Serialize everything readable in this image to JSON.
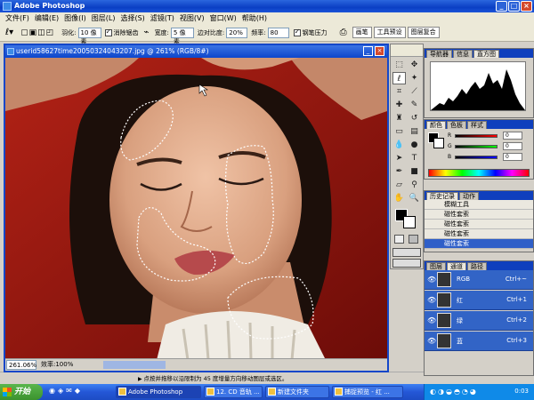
{
  "app": {
    "title": "Adobe Photoshop"
  },
  "menu": [
    "文件(F)",
    "编辑(E)",
    "图像(I)",
    "图层(L)",
    "选择(S)",
    "滤镜(T)",
    "视图(V)",
    "窗口(W)",
    "帮助(H)"
  ],
  "options": {
    "feather_label": "羽化:",
    "feather_value": "10 像素",
    "antialias_label": "消除锯齿",
    "width_label": "宽度:",
    "width_value": "5 像素",
    "edge_contrast_label": "边对比度:",
    "edge_contrast_value": "20%",
    "frequency_label": "频率:",
    "frequency_value": "80",
    "pen_pressure_label": "钢笔压力",
    "tabs": [
      "画笔",
      "工具预设",
      "图层复合"
    ]
  },
  "document": {
    "title": "userid58627time20050324043207.jpg @ 261% (RGB/8#)",
    "zoom": "261.06%",
    "efficiency": "效率:100%",
    "hint": "点按并拖移以沿限制为 45 度增量方向移动图层或选区。"
  },
  "navigator": {
    "tabs": [
      "导航器",
      "信息",
      "直方图"
    ]
  },
  "color": {
    "tabs": [
      "颜色",
      "色板",
      "样式"
    ],
    "channels": [
      {
        "label": "R",
        "value": "0"
      },
      {
        "label": "G",
        "value": "0"
      },
      {
        "label": "B",
        "value": "0"
      }
    ]
  },
  "history": {
    "tabs": [
      "历史记录",
      "动作"
    ],
    "items": [
      "磁性套索",
      "磁性套索",
      "磁性套索",
      "磁性套索"
    ],
    "first_item": "模糊工具",
    "selected_index": 3
  },
  "layers": {
    "tabs": [
      "图层",
      "通道",
      "路径"
    ],
    "channels": [
      {
        "name": "RGB",
        "shortcut": "Ctrl+~"
      },
      {
        "name": "红",
        "shortcut": "Ctrl+1"
      },
      {
        "name": "绿",
        "shortcut": "Ctrl+2"
      },
      {
        "name": "蓝",
        "shortcut": "Ctrl+3"
      }
    ]
  },
  "taskbar": {
    "start": "开始",
    "tasks": [
      "Adobe Photoshop",
      "12. CD 音轨 ...",
      "新建文件夹",
      "捕捉预览 - 红 ..."
    ],
    "clock": "0:03"
  },
  "icons": [
    "ps-logo-icon",
    "marquee-icon",
    "move-icon",
    "lasso-icon",
    "magic-wand-icon",
    "crop-icon",
    "slice-icon",
    "healing-icon",
    "brush-icon",
    "stamp-icon",
    "history-brush-icon",
    "eraser-icon",
    "gradient-icon",
    "blur-icon",
    "dodge-icon",
    "path-select-icon",
    "type-icon",
    "pen-icon",
    "shape-icon",
    "notes-icon",
    "eyedropper-icon",
    "hand-icon",
    "zoom-icon",
    "eye-icon",
    "start-flag-icon"
  ],
  "colors": {
    "titlebar": "#0a3fc4",
    "taskbar": "#2457d6",
    "selection": "#2f5fc8",
    "canvas_bg": "#8f1611"
  }
}
